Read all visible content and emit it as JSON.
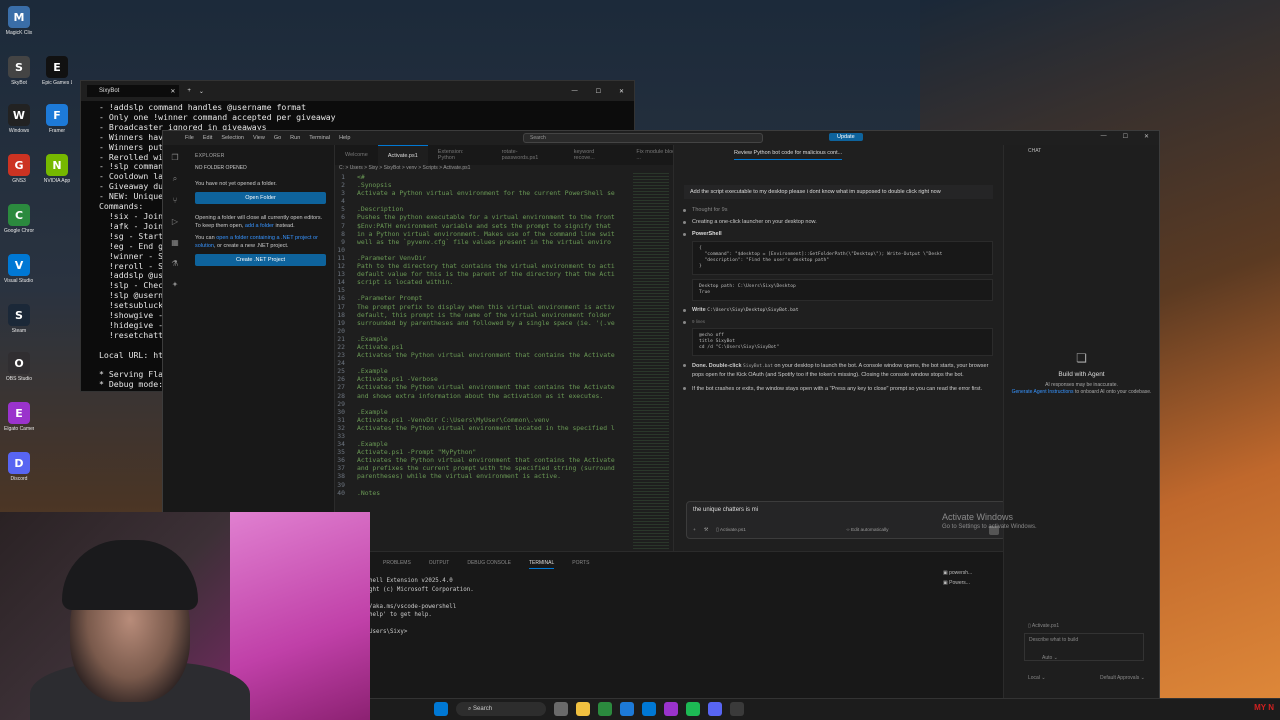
{
  "desktop": {
    "icons": [
      {
        "label": "MagicK Clix",
        "color": "#3a6ea8",
        "glyph": "M"
      },
      {
        "label": "SkyBot",
        "color": "#444",
        "glyph": "S"
      },
      {
        "label": "Epic Games Launcher",
        "color": "#111",
        "glyph": "E"
      },
      {
        "label": "Windows",
        "color": "#222",
        "glyph": "W"
      },
      {
        "label": "Framer",
        "color": "#1d7ad8",
        "glyph": "F"
      },
      {
        "label": "GNS3",
        "color": "#cc3322",
        "glyph": "G"
      },
      {
        "label": "NVIDIA App",
        "color": "#76b900",
        "glyph": "N"
      },
      {
        "label": "Google Chrome",
        "color": "#2b8a3e",
        "glyph": "C"
      },
      {
        "label": "Visual Studio Code",
        "color": "#0078d4",
        "glyph": "V"
      },
      {
        "label": "Steam",
        "color": "#1b2838",
        "glyph": "S"
      },
      {
        "label": "OBS Studio",
        "color": "#302e31",
        "glyph": "O"
      },
      {
        "label": "Elgato Camera Hub",
        "color": "#9a33cc",
        "glyph": "E"
      },
      {
        "label": "Discord",
        "color": "#5865f2",
        "glyph": "D"
      }
    ]
  },
  "terminal": {
    "tab_label": "SixyBot",
    "lines": [
      "- !addslp command handles @username format",
      "- Only one !winner command accepted per giveaway",
      "- Broadcaster ignored in giveaways",
      "- Winners have",
      "- Winners put",
      "- Rerolled win",
      "- !slp command",
      "- Cooldown las",
      "- Giveaway dur",
      "- NEW: Unique",
      "Commands:",
      "  !six - Join",
      "  !afk - Join",
      "  !sg - Start",
      "  !eg - End gi",
      "  !winner - Se",
      "  !reroll - Se",
      "  !addslp @use",
      "  !slp - Check",
      "  !slp @userna",
      "  !setsubluck",
      "  !showgive -",
      "  !hidegive -",
      "  !resetchatte",
      "",
      "Local URL: htt",
      "",
      "* Serving Flask a",
      "* Debug mode: off"
    ]
  },
  "vscode": {
    "menu": [
      "File",
      "Edit",
      "Selection",
      "View",
      "Go",
      "Run",
      "Terminal",
      "Help"
    ],
    "search_placeholder": "Search",
    "update_label": "Update",
    "explorer": {
      "header": "EXPLORER",
      "section": "NO FOLDER OPENED",
      "msg1": "You have not yet opened a folder.",
      "open_folder": "Open Folder",
      "msg2": "Opening a folder will close all currently open editors. To keep them open,",
      "msg2_link": "add a folder",
      "msg2_end": "instead.",
      "msg3": "You can",
      "msg3_link": "open a folder containing a .NET project or solution",
      "msg3_end": ", or create a new .NET project.",
      "create_net": "Create .NET Project"
    },
    "tabs": [
      "Welcome",
      "Activate.ps1",
      "Extension: Python",
      "rotate-passwords.ps1",
      "keyword recove...",
      "Fix module blocked from ...",
      "Review Python bot code fo..."
    ],
    "breadcrumb": "C: > Users > Sixy > SixyBot > venv > Scripts > Activate.ps1",
    "code_lines": [
      {
        "n": "1",
        "t": "<#"
      },
      {
        "n": "2",
        "t": ".Synopsis"
      },
      {
        "n": "3",
        "t": "Activate a Python virtual environment for the current PowerShell se"
      },
      {
        "n": "4",
        "t": ""
      },
      {
        "n": "5",
        "t": ".Description"
      },
      {
        "n": "6",
        "t": "Pushes the python executable for a virtual environment to the front"
      },
      {
        "n": "7",
        "t": "$Env:PATH environment variable and sets the prompt to signify that"
      },
      {
        "n": "8",
        "t": "in a Python virtual environment. Makes use of the command line swit"
      },
      {
        "n": "9",
        "t": "well as the `pyvenv.cfg` file values present in the virtual enviro"
      },
      {
        "n": "10",
        "t": ""
      },
      {
        "n": "11",
        "t": ".Parameter VenvDir"
      },
      {
        "n": "12",
        "t": "Path to the directory that contains the virtual environment to acti"
      },
      {
        "n": "13",
        "t": "default value for this is the parent of the directory that the Acti"
      },
      {
        "n": "14",
        "t": "script is located within."
      },
      {
        "n": "15",
        "t": ""
      },
      {
        "n": "16",
        "t": ".Parameter Prompt"
      },
      {
        "n": "17",
        "t": "The prompt prefix to display when this virtual environment is activ"
      },
      {
        "n": "18",
        "t": "default, this prompt is the name of the virtual environment folder"
      },
      {
        "n": "19",
        "t": "surrounded by parentheses and followed by a single space (ie. '(.ve"
      },
      {
        "n": "20",
        "t": ""
      },
      {
        "n": "21",
        "t": ".Example"
      },
      {
        "n": "22",
        "t": "Activate.ps1"
      },
      {
        "n": "23",
        "t": "Activates the Python virtual environment that contains the Activate"
      },
      {
        "n": "24",
        "t": ""
      },
      {
        "n": "25",
        "t": ".Example"
      },
      {
        "n": "26",
        "t": "Activate.ps1 -Verbose"
      },
      {
        "n": "27",
        "t": "Activates the Python virtual environment that contains the Activate"
      },
      {
        "n": "28",
        "t": "and shows extra information about the activation as it executes."
      },
      {
        "n": "29",
        "t": ""
      },
      {
        "n": "30",
        "t": ".Example"
      },
      {
        "n": "31",
        "t": "Activate.ps1 -VenvDir C:\\Users\\MyUser\\Common\\.venv"
      },
      {
        "n": "32",
        "t": "Activates the Python virtual environment located in the specified l"
      },
      {
        "n": "33",
        "t": ""
      },
      {
        "n": "34",
        "t": ".Example"
      },
      {
        "n": "35",
        "t": "Activate.ps1 -Prompt \"MyPython\""
      },
      {
        "n": "36",
        "t": "Activates the Python virtual environment that contains the Activate"
      },
      {
        "n": "37",
        "t": "and prefixes the current prompt with the specified string (surround"
      },
      {
        "n": "38",
        "t": "parentheses) while the virtual environment is active."
      },
      {
        "n": "39",
        "t": ""
      },
      {
        "n": "40",
        "t": ".Notes"
      }
    ],
    "chat": {
      "tab_chat": "CHAT",
      "title": "Review Python bot code for malicious cont...",
      "user_msg": "Add the script executable to my desktop please i dont know what im supposed to double click right now",
      "thought": "Thought for 9s",
      "creating": "Creating a one-click launcher on your desktop now.",
      "ps_label": "PowerShell",
      "ps_code": "{\n  \"command\": \"$desktop = [Environment]::GetFolderPath(\\\"Desktop\\\"); Write-Output \\\"Deskt\n  \"description\": \"Find the user's desktop path\"\n}",
      "ps_out": "Desktop path: C:\\Users\\Sixy\\Desktop\nTrue",
      "write_label": "Write",
      "write_path": "C:\\Users\\Sixy\\Desktop\\SixyBot.bat",
      "write_lines": "9 lines",
      "bat_code": "@echo off\ntitle SixyBot\ncd /d \"C:\\Users\\Sixy\\SixyBot\"",
      "done_bold": "Done. Double-click",
      "done_file": "SixyBot.bat",
      "done_text": "on your desktop to launch the bot. A console window opens, the bot starts, your browser pops open for the Kick OAuth (and Spotify too if the token's missing). Closing the console window stops the bot.",
      "done_text2": "If the bot crashes or exits, the window stays open with a \"Press any key to close\" prompt so you can read the error first.",
      "input_value": "the unique chatters is mi",
      "input_file": "Activate.ps1",
      "input_mode": "Edit automatically"
    },
    "agent": {
      "title": "Build with Agent",
      "note1": "AI responses may be inaccurate.",
      "note_link": "Generate Agent Instructions",
      "note2": "to onboard AI onto your codebase.",
      "file": "Activate.ps1",
      "placeholder": "Describe what to build",
      "auto": "Auto",
      "local": "Local",
      "approvals": "Default Approvals"
    },
    "panel": {
      "tabs": [
        "PROBLEMS",
        "OUTPUT",
        "DEBUG CONSOLE",
        "TERMINAL",
        "PORTS"
      ],
      "lines": [
        "hell Extension v2025.4.0",
        "ght (c) Microsoft Corporation.",
        "",
        "/aka.ms/vscode-powershell",
        "help' to get help.",
        "",
        "Users\\Sixy>"
      ],
      "sessions": [
        "powersh...",
        "Powers..."
      ]
    }
  },
  "activate_windows": {
    "title": "Activate Windows",
    "sub": "Go to Settings to activate Windows."
  },
  "taskbar": {
    "search": "Search",
    "tray_text": "MY N"
  }
}
